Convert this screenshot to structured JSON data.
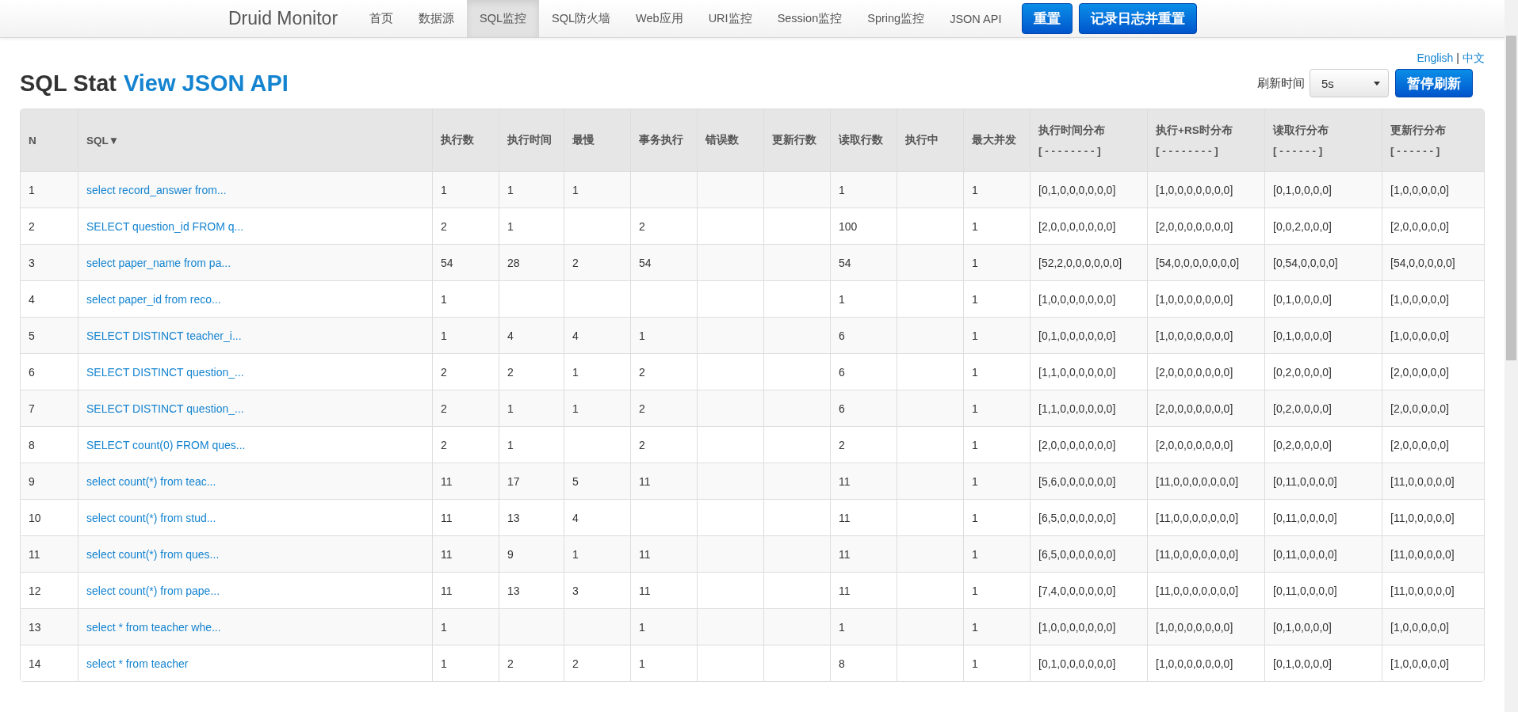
{
  "navbar": {
    "brand": "Druid Monitor",
    "items": [
      {
        "label": "首页",
        "selected": false
      },
      {
        "label": "数据源",
        "selected": false
      },
      {
        "label": "SQL监控",
        "selected": true
      },
      {
        "label": "SQL防火墙",
        "selected": false
      },
      {
        "label": "Web应用",
        "selected": false
      },
      {
        "label": "URI监控",
        "selected": false
      },
      {
        "label": "Session监控",
        "selected": false
      },
      {
        "label": "Spring监控",
        "selected": false
      },
      {
        "label": "JSON API",
        "selected": false
      }
    ],
    "buttons": [
      "重置",
      "记录日志并重置"
    ]
  },
  "language_links": [
    "English",
    "中文"
  ],
  "language_separator": "|",
  "title": {
    "text": "SQL Stat",
    "link": "View JSON API"
  },
  "refresh": {
    "label": "刷新时间",
    "interval": "5s",
    "button": "暂停刷新"
  },
  "table": {
    "columns": [
      {
        "label": "N",
        "kind": "text"
      },
      {
        "label": "SQL▼",
        "kind": "link"
      },
      {
        "label": "执行数",
        "kind": "text"
      },
      {
        "label": "执行时间",
        "kind": "text"
      },
      {
        "label": "最慢",
        "kind": "text"
      },
      {
        "label": "事务执行",
        "kind": "text"
      },
      {
        "label": "错误数",
        "kind": "text"
      },
      {
        "label": "更新行数",
        "kind": "text"
      },
      {
        "label": "读取行数",
        "kind": "text"
      },
      {
        "label": "执行中",
        "kind": "text"
      },
      {
        "label": "最大并发",
        "kind": "text"
      },
      {
        "label": "执行时间分布",
        "sub": "[ - - - - - - - - ]",
        "kind": "text"
      },
      {
        "label": "执行+RS时分布",
        "sub": "[ - - - - - - - - ]",
        "kind": "text"
      },
      {
        "label": "读取行分布",
        "sub": "[ - - - - - - ]",
        "kind": "text"
      },
      {
        "label": "更新行分布",
        "sub": "[ - - - - - - ]",
        "kind": "text"
      }
    ],
    "rows": [
      [
        "1",
        "select record_answer from...",
        "1",
        "1",
        "1",
        "",
        "",
        "",
        "1",
        "",
        "1",
        "[0,1,0,0,0,0,0,0]",
        "[1,0,0,0,0,0,0,0]",
        "[0,1,0,0,0,0]",
        "[1,0,0,0,0,0]"
      ],
      [
        "2",
        "SELECT question_id FROM q...",
        "2",
        "1",
        "",
        "2",
        "",
        "",
        "100",
        "",
        "1",
        "[2,0,0,0,0,0,0,0]",
        "[2,0,0,0,0,0,0,0]",
        "[0,0,2,0,0,0]",
        "[2,0,0,0,0,0]"
      ],
      [
        "3",
        "select paper_name from pa...",
        "54",
        "28",
        "2",
        "54",
        "",
        "",
        "54",
        "",
        "1",
        "[52,2,0,0,0,0,0,0]",
        "[54,0,0,0,0,0,0,0]",
        "[0,54,0,0,0,0]",
        "[54,0,0,0,0,0]"
      ],
      [
        "4",
        "select paper_id from reco...",
        "1",
        "",
        "",
        "",
        "",
        "",
        "1",
        "",
        "1",
        "[1,0,0,0,0,0,0,0]",
        "[1,0,0,0,0,0,0,0]",
        "[0,1,0,0,0,0]",
        "[1,0,0,0,0,0]"
      ],
      [
        "5",
        "SELECT DISTINCT teacher_i...",
        "1",
        "4",
        "4",
        "1",
        "",
        "",
        "6",
        "",
        "1",
        "[0,1,0,0,0,0,0,0]",
        "[1,0,0,0,0,0,0,0]",
        "[0,1,0,0,0,0]",
        "[1,0,0,0,0,0]"
      ],
      [
        "6",
        "SELECT DISTINCT question_...",
        "2",
        "2",
        "1",
        "2",
        "",
        "",
        "6",
        "",
        "1",
        "[1,1,0,0,0,0,0,0]",
        "[2,0,0,0,0,0,0,0]",
        "[0,2,0,0,0,0]",
        "[2,0,0,0,0,0]"
      ],
      [
        "7",
        "SELECT DISTINCT question_...",
        "2",
        "1",
        "1",
        "2",
        "",
        "",
        "6",
        "",
        "1",
        "[1,1,0,0,0,0,0,0]",
        "[2,0,0,0,0,0,0,0]",
        "[0,2,0,0,0,0]",
        "[2,0,0,0,0,0]"
      ],
      [
        "8",
        "SELECT count(0) FROM ques...",
        "2",
        "1",
        "",
        "2",
        "",
        "",
        "2",
        "",
        "1",
        "[2,0,0,0,0,0,0,0]",
        "[2,0,0,0,0,0,0,0]",
        "[0,2,0,0,0,0]",
        "[2,0,0,0,0,0]"
      ],
      [
        "9",
        "select count(*) from teac...",
        "11",
        "17",
        "5",
        "11",
        "",
        "",
        "11",
        "",
        "1",
        "[5,6,0,0,0,0,0,0]",
        "[11,0,0,0,0,0,0,0]",
        "[0,11,0,0,0,0]",
        "[11,0,0,0,0,0]"
      ],
      [
        "10",
        "select count(*) from stud...",
        "11",
        "13",
        "4",
        "",
        "",
        "",
        "11",
        "",
        "1",
        "[6,5,0,0,0,0,0,0]",
        "[11,0,0,0,0,0,0,0]",
        "[0,11,0,0,0,0]",
        "[11,0,0,0,0,0]"
      ],
      [
        "11",
        "select count(*) from ques...",
        "11",
        "9",
        "1",
        "11",
        "",
        "",
        "11",
        "",
        "1",
        "[6,5,0,0,0,0,0,0]",
        "[11,0,0,0,0,0,0,0]",
        "[0,11,0,0,0,0]",
        "[11,0,0,0,0,0]"
      ],
      [
        "12",
        "select count(*) from pape...",
        "11",
        "13",
        "3",
        "11",
        "",
        "",
        "11",
        "",
        "1",
        "[7,4,0,0,0,0,0,0]",
        "[11,0,0,0,0,0,0,0]",
        "[0,11,0,0,0,0]",
        "[11,0,0,0,0,0]"
      ],
      [
        "13",
        "select * from teacher whe...",
        "1",
        "",
        "",
        "1",
        "",
        "",
        "1",
        "",
        "1",
        "[1,0,0,0,0,0,0,0]",
        "[1,0,0,0,0,0,0,0]",
        "[0,1,0,0,0,0]",
        "[1,0,0,0,0,0]"
      ],
      [
        "14",
        "select * from teacher",
        "1",
        "2",
        "2",
        "1",
        "",
        "",
        "8",
        "",
        "1",
        "[0,1,0,0,0,0,0,0]",
        "[1,0,0,0,0,0,0,0]",
        "[0,1,0,0,0,0]",
        "[1,0,0,0,0,0]"
      ]
    ]
  }
}
